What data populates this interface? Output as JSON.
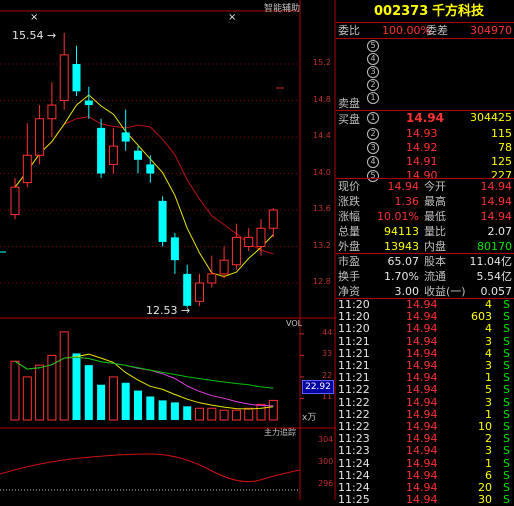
{
  "indicators": {
    "main_label": "智能辅助",
    "vol_label": "VOL",
    "vol_value": "22.92",
    "vol_unit": "x万",
    "vol_ticks": [
      "44",
      "33",
      "22",
      "11"
    ],
    "sub_label": "主力追踪",
    "sub_ticks": [
      "304",
      "300",
      "296"
    ],
    "price_ticks": [
      "15.2",
      "14.8",
      "14.4",
      "14.0",
      "13.6",
      "13.2",
      "12.8"
    ],
    "high_marker": "15.54",
    "low_marker": "12.53"
  },
  "colors": {
    "up": "#ff3232",
    "down": "#00ffff",
    "ma_short": "#e6e600",
    "ma_long": "#c01010",
    "vol_ma1": "#e6e600",
    "vol_ma2": "#e040e0",
    "vol_ma3": "#00c000",
    "grid": "#8b0000"
  },
  "quote": {
    "code": "002373",
    "name": "千方科技",
    "weibi_label": "委比",
    "weibi_value": "100.00%",
    "weicha_label": "委差",
    "weicha_value": "304970",
    "sell_label": "卖盘",
    "buy_label": "买盘",
    "sell_levels": [
      "5",
      "4",
      "3",
      "2",
      "1"
    ],
    "buy_levels": [
      {
        "n": "1",
        "price": "14.94",
        "vol": "304425"
      },
      {
        "n": "2",
        "price": "14.93",
        "vol": "115"
      },
      {
        "n": "3",
        "price": "14.92",
        "vol": "78"
      },
      {
        "n": "4",
        "price": "14.91",
        "vol": "125"
      },
      {
        "n": "5",
        "price": "14.90",
        "vol": "227"
      }
    ],
    "stats": [
      {
        "l1": "现价",
        "v1": "14.94",
        "l2": "今开",
        "v2": "14.94"
      },
      {
        "l1": "涨跌",
        "v1": "1.36",
        "l2": "最高",
        "v2": "14.94"
      },
      {
        "l1": "涨幅",
        "v1": "10.01%",
        "l2": "最低",
        "v2": "14.94"
      },
      {
        "l1": "总量",
        "v1": "94113",
        "l2": "量比",
        "v2": "2.07"
      },
      {
        "l1": "外盘",
        "v1": "13943",
        "l2": "内盘",
        "v2": "80170"
      }
    ],
    "fundamentals": [
      {
        "l1": "市盈",
        "v1": "65.07",
        "l2": "股本",
        "v2": "11.04亿"
      },
      {
        "l1": "换手",
        "v1": "1.70%",
        "l2": "流通",
        "v2": "5.54亿"
      },
      {
        "l1": "净资",
        "v1": "3.00",
        "l2": "收益(一)",
        "v2": "0.057"
      }
    ],
    "ticks": [
      {
        "t": "11:20",
        "p": "14.94",
        "v": "4",
        "s": "S"
      },
      {
        "t": "11:20",
        "p": "14.94",
        "v": "603",
        "s": "S"
      },
      {
        "t": "11:20",
        "p": "14.94",
        "v": "4",
        "s": "S"
      },
      {
        "t": "11:21",
        "p": "14.94",
        "v": "3",
        "s": "S"
      },
      {
        "t": "11:21",
        "p": "14.94",
        "v": "4",
        "s": "S"
      },
      {
        "t": "11:21",
        "p": "14.94",
        "v": "3",
        "s": "S"
      },
      {
        "t": "11:21",
        "p": "14.94",
        "v": "1",
        "s": "S"
      },
      {
        "t": "11:22",
        "p": "14.94",
        "v": "5",
        "s": "S"
      },
      {
        "t": "11:22",
        "p": "14.94",
        "v": "3",
        "s": "S"
      },
      {
        "t": "11:22",
        "p": "14.94",
        "v": "1",
        "s": "S"
      },
      {
        "t": "11:22",
        "p": "14.94",
        "v": "10",
        "s": "S"
      },
      {
        "t": "11:23",
        "p": "14.94",
        "v": "2",
        "s": "S"
      },
      {
        "t": "11:23",
        "p": "14.94",
        "v": "3",
        "s": "S"
      },
      {
        "t": "11:24",
        "p": "14.94",
        "v": "1",
        "s": "S"
      },
      {
        "t": "11:24",
        "p": "14.94",
        "v": "6",
        "s": "S"
      },
      {
        "t": "11:24",
        "p": "14.94",
        "v": "20",
        "s": "S"
      },
      {
        "t": "11:25",
        "p": "14.94",
        "v": "30",
        "s": "S"
      }
    ]
  },
  "chart_data": {
    "type": "candlestick",
    "price_axis": [
      12.53,
      15.54
    ],
    "candles": [
      {
        "o": 13.55,
        "c": 13.85,
        "h": 13.95,
        "l": 13.5
      },
      {
        "o": 13.9,
        "c": 14.2,
        "h": 14.55,
        "l": 13.85
      },
      {
        "o": 14.2,
        "c": 14.6,
        "h": 14.75,
        "l": 14.1
      },
      {
        "o": 14.6,
        "c": 14.75,
        "h": 15.0,
        "l": 14.4
      },
      {
        "o": 14.8,
        "c": 15.3,
        "h": 15.54,
        "l": 14.7
      },
      {
        "o": 15.2,
        "c": 14.9,
        "h": 15.4,
        "l": 14.85
      },
      {
        "o": 14.8,
        "c": 14.75,
        "h": 14.95,
        "l": 14.6
      },
      {
        "o": 14.5,
        "c": 14.0,
        "h": 14.6,
        "l": 13.95
      },
      {
        "o": 14.1,
        "c": 14.3,
        "h": 14.5,
        "l": 14.0
      },
      {
        "o": 14.45,
        "c": 14.35,
        "h": 14.7,
        "l": 14.25
      },
      {
        "o": 14.25,
        "c": 14.15,
        "h": 14.3,
        "l": 14.0
      },
      {
        "o": 14.1,
        "c": 14.0,
        "h": 14.2,
        "l": 13.9
      },
      {
        "o": 13.7,
        "c": 13.25,
        "h": 13.75,
        "l": 13.2
      },
      {
        "o": 13.3,
        "c": 13.05,
        "h": 13.35,
        "l": 12.9
      },
      {
        "o": 12.9,
        "c": 12.55,
        "h": 13.0,
        "l": 12.53
      },
      {
        "o": 12.6,
        "c": 12.8,
        "h": 12.9,
        "l": 12.55
      },
      {
        "o": 12.8,
        "c": 12.9,
        "h": 13.1,
        "l": 12.75
      },
      {
        "o": 12.9,
        "c": 13.05,
        "h": 13.2,
        "l": 12.85
      },
      {
        "o": 13.0,
        "c": 13.3,
        "h": 13.45,
        "l": 12.95
      },
      {
        "o": 13.2,
        "c": 13.3,
        "h": 13.4,
        "l": 13.15
      },
      {
        "o": 13.2,
        "c": 13.4,
        "h": 13.5,
        "l": 13.1
      },
      {
        "o": 13.4,
        "c": 13.6,
        "h": 13.62,
        "l": 13.3
      }
    ],
    "volume": [
      30,
      22,
      28,
      33,
      45,
      34,
      28,
      18,
      22,
      19,
      15,
      12,
      10,
      9,
      7,
      6,
      6,
      5,
      5,
      6,
      8,
      10
    ],
    "vol_range": [
      0,
      48
    ]
  }
}
